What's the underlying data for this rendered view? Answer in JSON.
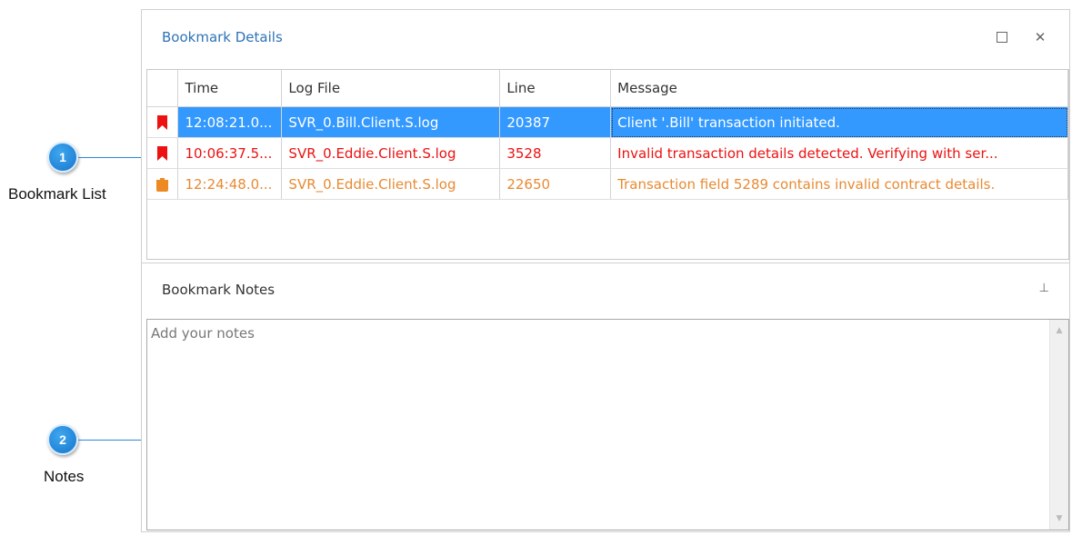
{
  "panel": {
    "title": "Bookmark Details",
    "maximize_icon": "square-icon",
    "close_label": "✕"
  },
  "grid": {
    "columns": [
      "",
      "Time",
      "Log File",
      "Line",
      "Message"
    ],
    "rows": [
      {
        "icon": "red-bookmark-flag-icon",
        "time": "12:08:21.0...",
        "log_file": "SVR_0.Bill.Client.S.log",
        "line": "20387",
        "message": "Client '.Bill' transaction initiated.",
        "selected": true
      },
      {
        "icon": "red-bookmark-flag-icon",
        "time": "10:06:37.5...",
        "log_file": "SVR_0.Eddie.Client.S.log",
        "line": "3528",
        "message": "Invalid transaction details detected.  Verifying with ser...",
        "color": "#ee1111"
      },
      {
        "icon": "orange-bookmark-icon",
        "time": "12:24:48.0...",
        "log_file": "SVR_0.Eddie.Client.S.log",
        "line": "22650",
        "message": "Transaction field 5289 contains invalid contract details.",
        "color": "#e88a32"
      }
    ]
  },
  "notes": {
    "title": "Bookmark Notes",
    "pin_label": "⊥",
    "placeholder": "Add your notes"
  },
  "callouts": [
    {
      "number": "1",
      "label": "Bookmark List"
    },
    {
      "number": "2",
      "label": "Notes"
    }
  ],
  "colors": {
    "accent": "#2e73b8",
    "selection": "#3399ff",
    "error_red": "#ee1111",
    "warning_orange": "#e88a32",
    "callout_blue": "#1775cc"
  }
}
